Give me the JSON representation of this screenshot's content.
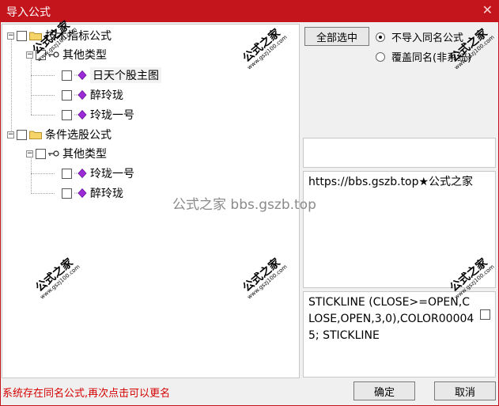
{
  "window": {
    "title": "导入公式",
    "close_glyph": "✕"
  },
  "tree": {
    "group1": {
      "label": "技术指标公式",
      "expander": "−",
      "sub": {
        "label": "其他类型",
        "expander": "−",
        "items": [
          {
            "label": "日天个股主图"
          },
          {
            "label": "醉玲珑"
          },
          {
            "label": "玲珑一号"
          }
        ]
      }
    },
    "group2": {
      "label": "条件选股公式",
      "expander": "−",
      "sub": {
        "label": "其他类型",
        "expander": "−",
        "items": [
          {
            "label": "玲珑一号"
          },
          {
            "label": "醉玲珑"
          }
        ]
      }
    }
  },
  "options": {
    "select_all_label": "全部选中",
    "radio_no_import": "不导入同名公式",
    "radio_overwrite": "覆盖同名(非系统)"
  },
  "info_text": "https://bbs.gszb.top★公式之家",
  "code_text": "STICKLINE (CLOSE>=OPEN,CLOSE,OPEN,3,0),COLOR000045; STICKLINE",
  "status_text": "系统存在同名公式,再次点击可以更名",
  "buttons": {
    "ok": "确定",
    "cancel": "取消"
  },
  "watermarks": {
    "site_cn": "公式之家",
    "site_url": "www.gszj100.com",
    "center": "公式之家 bbs.gszb.top"
  },
  "colors": {
    "titlebar": "#c4141c",
    "status_text": "#d40000",
    "formula_icon": "#9b2bd6"
  }
}
